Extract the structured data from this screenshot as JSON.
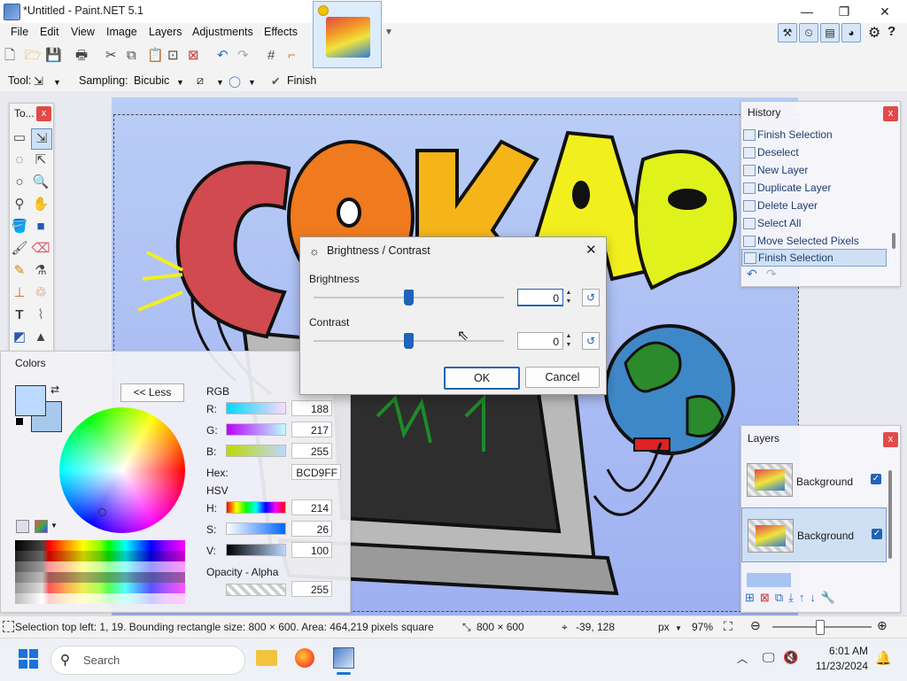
{
  "window": {
    "title": "*Untitled - Paint.NET 5.1",
    "minimize": "—",
    "maximize": "❐",
    "close": "✕"
  },
  "menu": [
    "File",
    "Edit",
    "View",
    "Image",
    "Layers",
    "Adjustments",
    "Effects"
  ],
  "toolrow": {
    "tool_label": "Tool:",
    "sampling_label": "Sampling:",
    "sampling_value": "Bicubic",
    "finish_label": "Finish"
  },
  "tools_panel": {
    "title": "To...",
    "close": "x"
  },
  "colors_panel": {
    "title": "Colors",
    "less_button": "<< Less",
    "rgb_label": "RGB",
    "r_label": "R:",
    "r_value": "188",
    "g_label": "G:",
    "g_value": "217",
    "b_label": "B:",
    "b_value": "255",
    "hex_label": "Hex:",
    "hex_value": "BCD9FF",
    "hsv_label": "HSV",
    "h_label": "H:",
    "h_value": "214",
    "s_label": "S:",
    "s_value": "26",
    "v_label": "V:",
    "v_value": "100",
    "opacity_label": "Opacity - Alpha",
    "alpha_value": "255",
    "primary_color": "#BCD9FF",
    "secondary_color": "#A9C8EE"
  },
  "history_panel": {
    "title": "History",
    "close": "x",
    "items": [
      "Finish Selection",
      "Deselect",
      "New Layer",
      "Duplicate Layer",
      "Delete Layer",
      "Select All",
      "Move Selected Pixels",
      "Finish Selection"
    ],
    "selected_index": 7
  },
  "layers_panel": {
    "title": "Layers",
    "close": "x",
    "layers": [
      {
        "name": "Background",
        "visible": true
      },
      {
        "name": "Background",
        "visible": true
      }
    ]
  },
  "dialog": {
    "title": "Brightness / Contrast",
    "brightness_label": "Brightness",
    "brightness_value": "0",
    "contrast_label": "Contrast",
    "contrast_value": "0",
    "ok_label": "OK",
    "cancel_label": "Cancel",
    "brightness_level": 0.5,
    "contrast_level": 0.5
  },
  "canvas_art": {
    "letters": [
      "C",
      "O",
      "K",
      "A",
      "B"
    ],
    "letter_colors": [
      "#d04a4f",
      "#f07a1e",
      "#f5b518",
      "#f2ef1e",
      "#dff21c"
    ]
  },
  "status": {
    "selection_text": "Selection top left: 1, 19. Bounding rectangle size: 800 × 600. Area: 464,219 pixels square",
    "image_size": "800 × 600",
    "cursor_pos": "-39, 128",
    "units": "px",
    "zoom": "97%"
  },
  "taskbar": {
    "search_placeholder": "Search",
    "time": "6:01 AM",
    "date": "11/23/2024"
  }
}
